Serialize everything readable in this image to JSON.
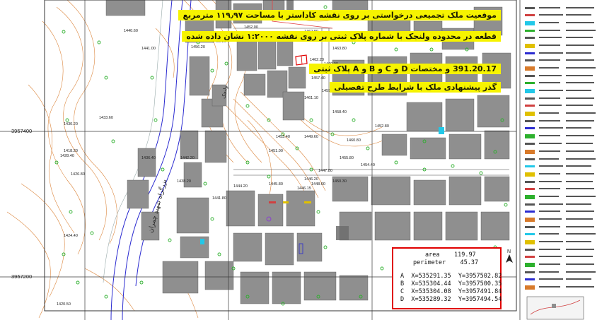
{
  "map": {
    "grid_labels": {
      "y_upper": "3957400",
      "y_lower": "3957200"
    },
    "colors": {
      "buildings": "#8f8f8f",
      "contours": "#d87a2a",
      "green": "#2db02d",
      "road": "#2b2bd0",
      "frame": "#3a3a3a",
      "highlight": "#f6f300",
      "box": "#e00000"
    },
    "elevations": [
      "1457.60",
      "1462.80",
      "1463.80",
      "1460.00",
      "1462.20",
      "1452.00",
      "1459.20",
      "1456.20",
      "1457.40",
      "1459.60",
      "1461.10",
      "1460.80",
      "1458.40",
      "1455.80",
      "1454.40",
      "1452.80",
      "1449.60",
      "1453.40",
      "1451.00",
      "1446.20",
      "1445.80",
      "1444.20",
      "1441.80",
      "1438.20",
      "1436.40",
      "1433.60",
      "1430.20",
      "1428.40",
      "1426.80",
      "1424.40",
      "1420.50",
      "1418.20",
      "1440.60",
      "1441.00",
      "1442.20",
      "1447.80",
      "1450.30",
      "1448.00",
      "1446.15"
    ],
    "street_labels": [
      "بزرگراه شهید چمران",
      "ولنجک"
    ],
    "north_arrow": "N"
  },
  "notes": [
    "موقعیت ملک تجمیعی درخواستی بر روی نقشه کاداستر با مساحت ۱۱۹٫۹۷ مترمربع",
    "قطعه در محدوده ولنجک با شماره پلاک ثبتی بر روی نقشه ۱:۲۰۰۰ نشان داده شده",
    "391.20.17 و مختصات D و C و B و A پلاک ثبتی",
    "گذر پیشنهادی ملک با شرایط طرح تفصیلی"
  ],
  "info": {
    "area_label": "area",
    "area_value": "119.97",
    "perimeter_label": "perimeter",
    "perimeter_value": "45.37",
    "points": [
      {
        "name": "A",
        "x": "X=535291.35",
        "y": "Y=3957502.82"
      },
      {
        "name": "B",
        "x": "X=535304.44",
        "y": "Y=3957500.35"
      },
      {
        "name": "C",
        "x": "X=535304.08",
        "y": "Y=3957491.84"
      },
      {
        "name": "D",
        "x": "X=535289.32",
        "y": "Y=3957494.54"
      }
    ]
  }
}
